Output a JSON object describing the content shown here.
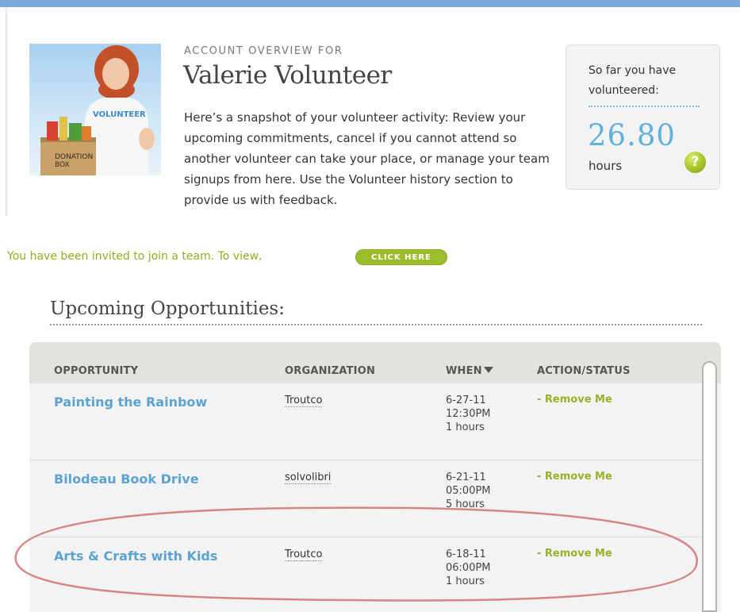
{
  "overview": {
    "label": "ACCOUNT OVERVIEW FOR",
    "name": "Valerie Volunteer",
    "intro": "Here’s a snapshot of your volunteer activity: Review your upcoming commitments, cancel if you cannot attend so another volunteer can take your place, or manage your team signups from here. Use the Volunteer history section to provide us with feedback.",
    "avatar": {
      "shirt_text": "VOLUNTEER",
      "box_text_line1": "DONATION",
      "box_text_line2": "BOX"
    }
  },
  "hours": {
    "prefix": "So far you have volunteered:",
    "value": "26.80",
    "unit": "hours",
    "help_icon": "?"
  },
  "invite": {
    "text": "You have been invited to join a team. To view,",
    "button": "CLICK HERE"
  },
  "upcoming": {
    "title": "Upcoming Opportunities:",
    "columns": {
      "opportunity": "OPPORTUNITY",
      "organization": "ORGANIZATION",
      "when": "WHEN",
      "action": "ACTION/STATUS"
    },
    "rows": [
      {
        "opportunity": "Painting the Rainbow",
        "organization": "Troutco",
        "date": "6-27-11",
        "time": "12:30PM",
        "duration": "1 hours",
        "action": "- Remove Me"
      },
      {
        "opportunity": "Bilodeau Book Drive",
        "organization": "solvolibri",
        "date": "6-21-11",
        "time": "05:00PM",
        "duration": "5 hours",
        "action": "- Remove Me"
      },
      {
        "opportunity": "Arts & Crafts with Kids",
        "organization": "Troutco",
        "date": "6-18-11",
        "time": "06:00PM",
        "duration": "1 hours",
        "action": "- Remove Me"
      }
    ]
  },
  "colors": {
    "accent_blue": "#5ba3d1",
    "accent_green": "#94b22a",
    "highlight_ring": "#d47a7a"
  },
  "icons": {
    "help": "question-mark-icon",
    "sort": "sort-down-arrow-icon"
  }
}
